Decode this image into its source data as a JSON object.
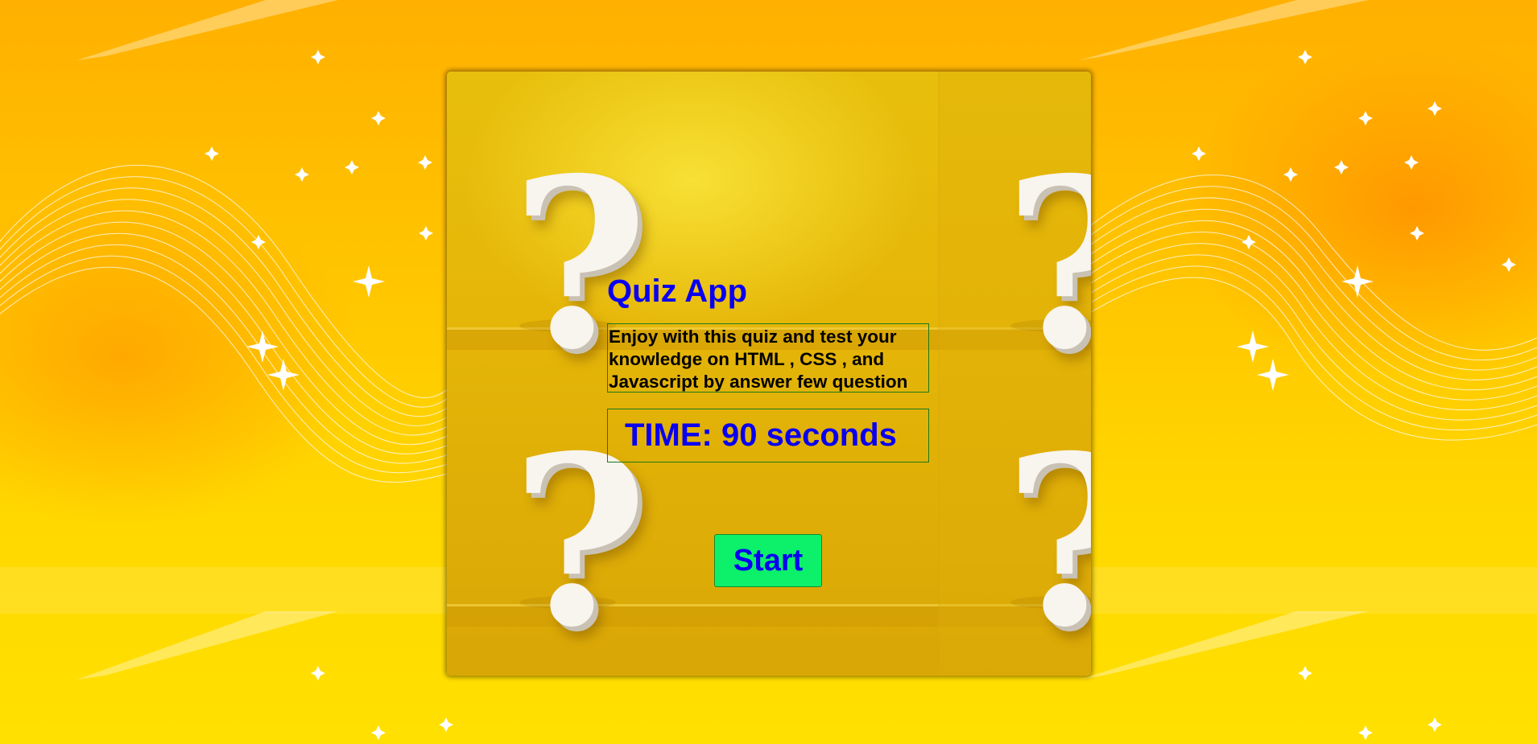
{
  "app": {
    "title": "Quiz App",
    "description": "Enjoy with this quiz and test your knowledge on HTML , CSS , and Javascript by answer few question",
    "timer_label": "TIME: 90 seconds",
    "start_label": "Start"
  },
  "background_images": {
    "question_mark": "?"
  },
  "colors": {
    "title": "#0a00f0",
    "start_button": "#0cf06a",
    "box_border": "#1a7a1a",
    "page_background": "#ffc400"
  }
}
